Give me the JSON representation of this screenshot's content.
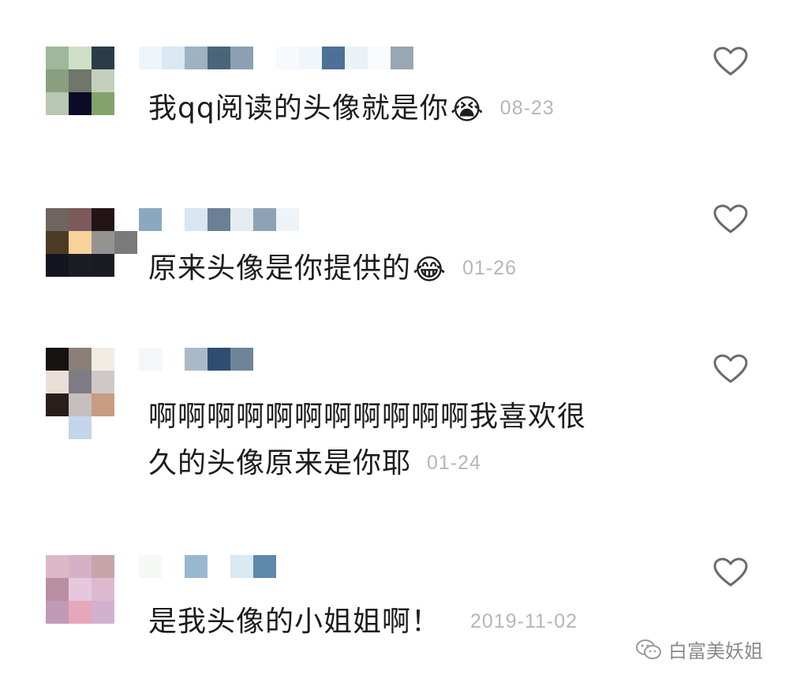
{
  "comments": [
    {
      "text": "我qq阅读的头像就是你",
      "emoji": "😭",
      "time": "08-23"
    },
    {
      "text": "原来头像是你提供的",
      "emoji": "😂",
      "time": "01-26"
    },
    {
      "text_line1": "啊啊啊啊啊啊啊啊啊啊啊我喜欢很",
      "text_line2": "久的头像原来是你耶",
      "time": "01-24"
    },
    {
      "text": "是我头像的小姐姐啊！",
      "time": "2019-11-02"
    }
  ],
  "watermark": {
    "label": "白富美妖姐",
    "icon": "wechat-icon"
  },
  "icons": {
    "like": "heart-outline-icon"
  }
}
